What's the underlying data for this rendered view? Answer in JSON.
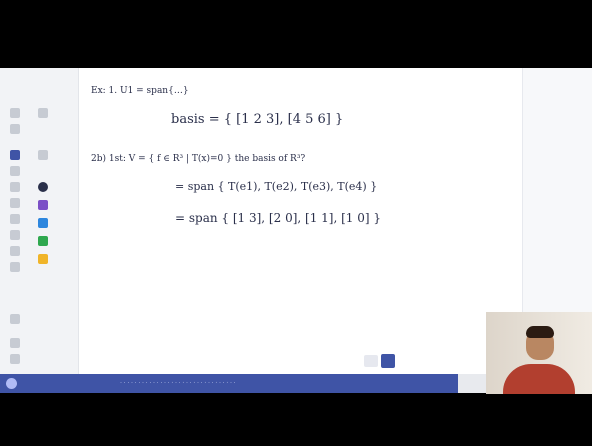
{
  "canvas": {
    "lines": [
      {
        "text": "Ex: 1. U1 = span{…}"
      },
      {
        "text": "basis = { [1 2 3], [4 5 6] }"
      },
      {
        "text": "2b) 1st: V = { f ∈ R³ | T(x)=0 } the basis of R³?"
      },
      {
        "text": "= span { T(e1), T(e2), T(e3), T(e4) }"
      },
      {
        "text": "= span { [1 3], [2 0], [1 1], [1 0] }"
      }
    ]
  },
  "bottom_bar": {
    "text": "· · · · · · · · · · · · · · · · · · · · · · · · · · · · · · · ·"
  },
  "page_indicator": {
    "current": "1",
    "total": "1"
  },
  "colors": {
    "accent": "#3f54a6",
    "palette": [
      "#2a2f4a",
      "#7b4fc6",
      "#2e86de",
      "#2fa84f",
      "#f0b429"
    ]
  }
}
